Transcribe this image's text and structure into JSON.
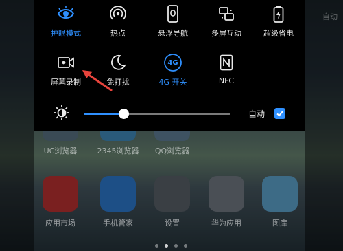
{
  "corner_text": "自动",
  "quick_settings": {
    "row1": [
      {
        "label": "护眼模式",
        "icon": "eye-icon",
        "active": true
      },
      {
        "label": "热点",
        "icon": "hotspot-icon",
        "active": false
      },
      {
        "label": "悬浮导航",
        "icon": "floating-nav-icon",
        "active": false
      },
      {
        "label": "多屏互动",
        "icon": "multi-screen-icon",
        "active": false
      },
      {
        "label": "超级省电",
        "icon": "battery-saver-icon",
        "active": false
      }
    ],
    "row2": [
      {
        "label": "屏幕录制",
        "icon": "screen-record-icon",
        "active": false
      },
      {
        "label": "免打扰",
        "icon": "moon-icon",
        "active": false
      },
      {
        "label": "4G 开关",
        "icon": "4g-icon",
        "icon_text": "4G",
        "active": true
      },
      {
        "label": "NFC",
        "icon": "nfc-icon",
        "active": false
      }
    ]
  },
  "brightness": {
    "level_percent": 27,
    "auto_label": "自动",
    "auto_checked": true
  },
  "home_apps": {
    "row1": [
      "UC浏览器",
      "2345浏览器",
      "QQ浏览器"
    ],
    "row2": [
      "应用市场",
      "手机管家",
      "设置",
      "华为应用",
      "图库"
    ]
  },
  "page_indicator": {
    "pages": 4,
    "current": 1
  },
  "colors": {
    "accent": "#2f90ff",
    "panel": "#000000",
    "arrow": "#e8443c"
  }
}
